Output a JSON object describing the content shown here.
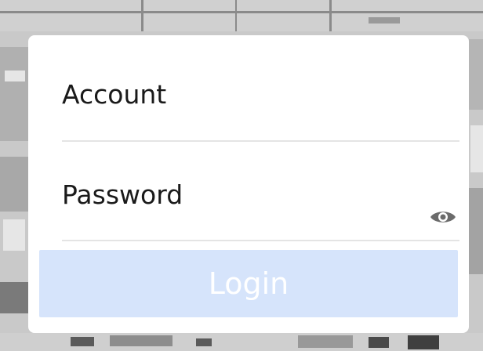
{
  "login_form": {
    "account_label": "Account",
    "password_label": "Password",
    "login_label": "Login",
    "password_visibility_icon": "eye-icon"
  },
  "colors": {
    "login_button_bg": "#d6e4fb",
    "login_button_text": "#ffffff",
    "card_bg": "#ffffff",
    "divider": "#e4e4e4",
    "eye_icon": "#6b6b6b"
  }
}
